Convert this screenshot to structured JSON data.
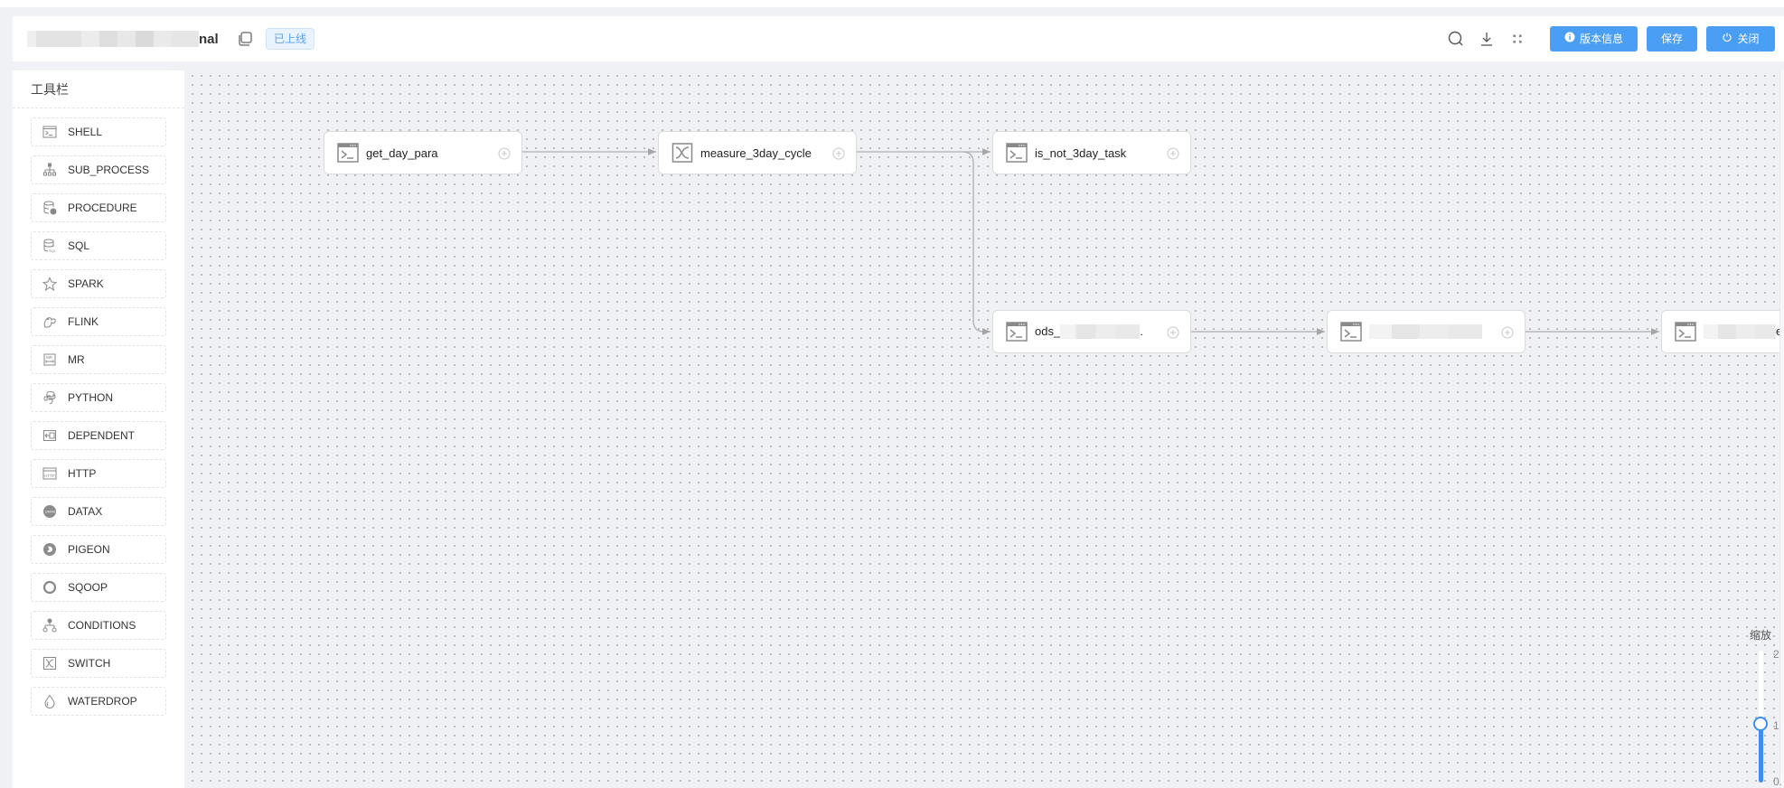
{
  "header": {
    "title_visible_suffix": "nal",
    "status_badge": "已上线",
    "buttons": {
      "version_info": "版本信息",
      "save": "保存",
      "close": "关闭"
    },
    "icons": [
      "search-icon",
      "download-icon",
      "fullscreen-icon"
    ]
  },
  "sidebar": {
    "title": "工具栏",
    "items": [
      {
        "label": "SHELL",
        "icon": "shell-icon"
      },
      {
        "label": "SUB_PROCESS",
        "icon": "sub-process-icon"
      },
      {
        "label": "PROCEDURE",
        "icon": "procedure-icon"
      },
      {
        "label": "SQL",
        "icon": "sql-icon"
      },
      {
        "label": "SPARK",
        "icon": "spark-icon"
      },
      {
        "label": "FLINK",
        "icon": "flink-icon"
      },
      {
        "label": "MR",
        "icon": "mr-icon"
      },
      {
        "label": "PYTHON",
        "icon": "python-icon"
      },
      {
        "label": "DEPENDENT",
        "icon": "dependent-icon"
      },
      {
        "label": "HTTP",
        "icon": "http-icon"
      },
      {
        "label": "DATAX",
        "icon": "datax-icon"
      },
      {
        "label": "PIGEON",
        "icon": "pigeon-icon"
      },
      {
        "label": "SQOOP",
        "icon": "sqoop-icon"
      },
      {
        "label": "CONDITIONS",
        "icon": "conditions-icon"
      },
      {
        "label": "SWITCH",
        "icon": "switch-icon"
      },
      {
        "label": "WATERDROP",
        "icon": "waterdrop-icon"
      }
    ]
  },
  "canvas": {
    "nodes": [
      {
        "label": "get_day_para",
        "type": "SHELL"
      },
      {
        "label": "measure_3day_cycle",
        "type": "SWITCH"
      },
      {
        "label": "is_not_3day_task",
        "type": "SHELL"
      },
      {
        "label": "ods_",
        "label_suffix": ".",
        "type": "SHELL",
        "redacted": true
      },
      {
        "label": "",
        "type": "SHELL",
        "redacted": true
      },
      {
        "label": "",
        "label_suffix": "e_",
        "type": "SHELL",
        "redacted": true
      }
    ],
    "edges": [
      {
        "from": "get_day_para",
        "to": "measure_3day_cycle"
      },
      {
        "from": "measure_3day_cycle",
        "to": "is_not_3day_task"
      },
      {
        "from": "measure_3day_cycle",
        "to": "ods_"
      },
      {
        "from": "ods_",
        "to": "node-5"
      },
      {
        "from": "node-5",
        "to": "node-6"
      }
    ]
  },
  "zoom_control": {
    "label": "缩放",
    "max_label": "2",
    "mid_label": "1",
    "min_label": "0.",
    "value": 1,
    "min": 0,
    "max": 2
  }
}
